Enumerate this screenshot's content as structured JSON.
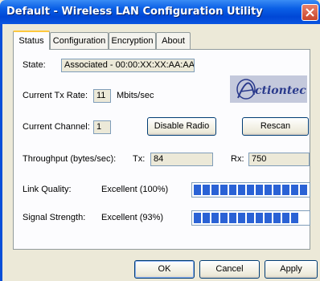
{
  "window": {
    "title": "Default - Wireless LAN Configuration Utility"
  },
  "tabs": [
    {
      "label": "Status"
    },
    {
      "label": "Configuration"
    },
    {
      "label": "Encryption"
    },
    {
      "label": "About"
    }
  ],
  "status": {
    "state_label": "State:",
    "state_value": "Associated - 00:00:XX:XX:AA:AA",
    "tx_rate_label": "Current Tx Rate:",
    "tx_rate_value": "11",
    "tx_rate_unit": "Mbits/sec",
    "channel_label": "Current Channel:",
    "channel_value": "1",
    "disable_radio": "Disable Radio",
    "rescan": "Rescan",
    "throughput_label": "Throughput (bytes/sec):",
    "tx_label": "Tx:",
    "tx_value": "84",
    "rx_label": "Rx:",
    "rx_value": "750",
    "link_quality_label": "Link Quality:",
    "link_quality_value": "Excellent (100%)",
    "link_quality_level": 1.0,
    "signal_strength_label": "Signal Strength:",
    "signal_strength_value": "Excellent (93%)",
    "signal_strength_level": 0.93
  },
  "logo": {
    "text": "Actiontec",
    "icon": "actiontec-logo"
  },
  "buttons": {
    "ok": "OK",
    "cancel": "Cancel",
    "apply": "Apply"
  },
  "colors": {
    "meter_fill": "#2a62d5",
    "titlebar": "#0047d6"
  }
}
